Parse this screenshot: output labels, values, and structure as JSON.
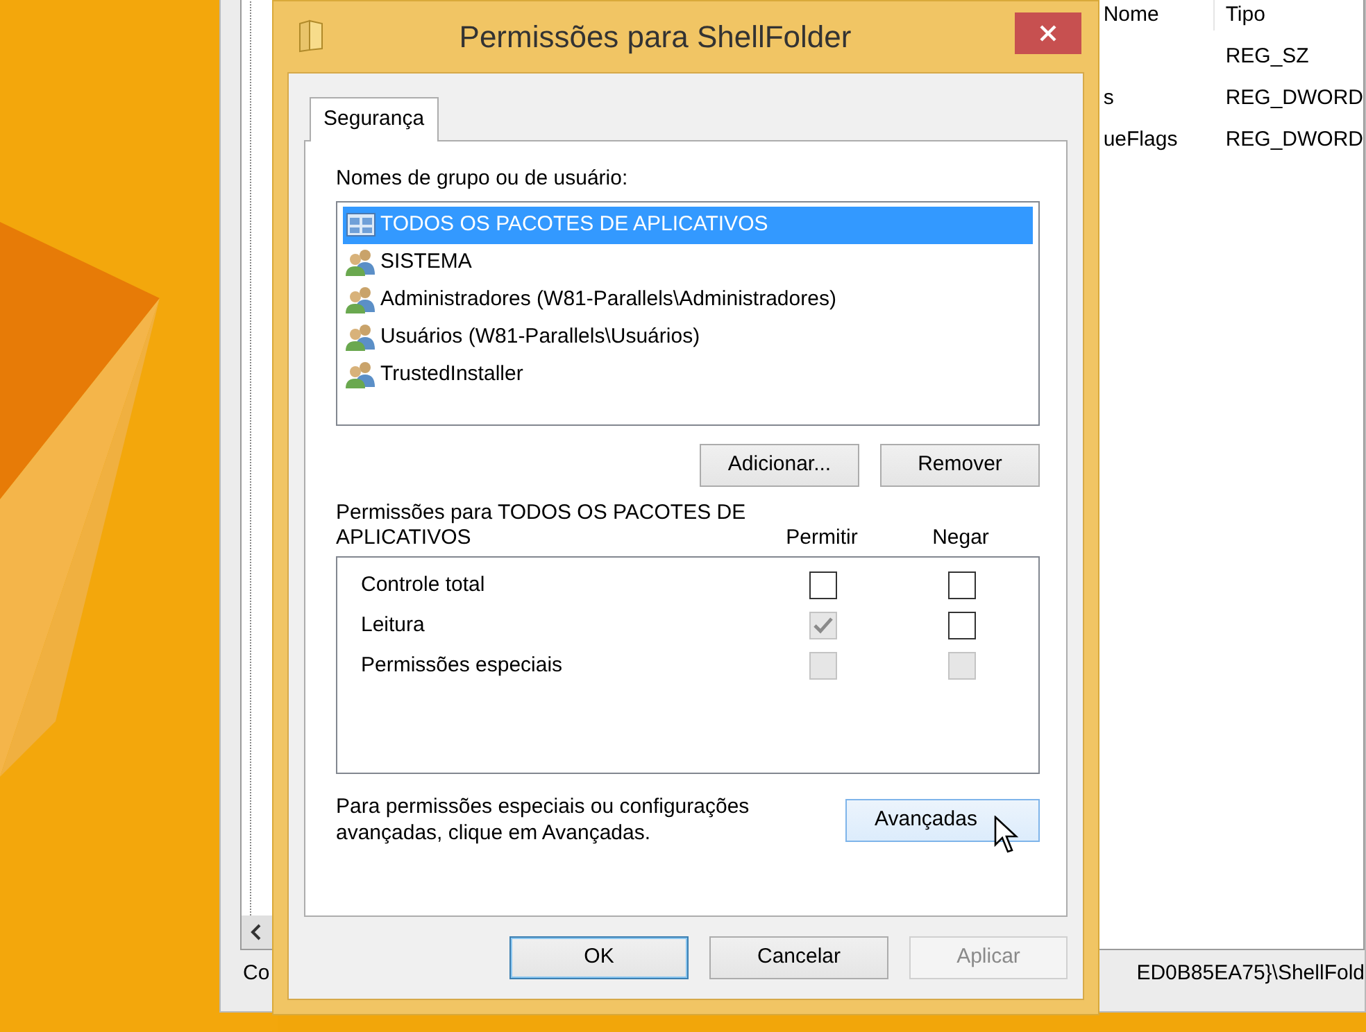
{
  "background_window": {
    "columns": [
      "Nome",
      "Tipo"
    ],
    "rows": [
      {
        "name": "",
        "type": "REG_SZ"
      },
      {
        "name": "s",
        "type": "REG_DWORD"
      },
      {
        "name": "ueFlags",
        "type": "REG_DWORD"
      }
    ],
    "status_bar": {
      "left": "Co",
      "right": "ED0B85EA75}\\ShellFold"
    }
  },
  "dialog": {
    "title": "Permissões para ShellFolder",
    "tabs": [
      {
        "label": "Segurança",
        "selected": true
      }
    ],
    "users_label": "Nomes de grupo ou de usuário:",
    "users": [
      {
        "label": "TODOS OS PACOTES DE APLICATIVOS",
        "kind": "package",
        "selected": true
      },
      {
        "label": "SISTEMA",
        "kind": "group",
        "selected": false
      },
      {
        "label": "Administradores (W81-Parallels\\Administradores)",
        "kind": "group",
        "selected": false
      },
      {
        "label": "Usuários (W81-Parallels\\Usuários)",
        "kind": "group",
        "selected": false
      },
      {
        "label": "TrustedInstaller",
        "kind": "group",
        "selected": false
      }
    ],
    "user_buttons": [
      "Adicionar...",
      "Remover"
    ],
    "permissions_label": "Permissões para TODOS OS PACOTES DE APLICATIVOS",
    "permission_columns": [
      "Permitir",
      "Negar"
    ],
    "permissions": [
      {
        "label": "Controle total",
        "allow": {
          "checked": false,
          "disabled": false
        },
        "deny": {
          "checked": false,
          "disabled": false
        }
      },
      {
        "label": "Leitura",
        "allow": {
          "checked": true,
          "disabled": true
        },
        "deny": {
          "checked": false,
          "disabled": false
        }
      },
      {
        "label": "Permissões especiais",
        "allow": {
          "checked": false,
          "disabled": true
        },
        "deny": {
          "checked": false,
          "disabled": true
        }
      }
    ],
    "advanced_text": "Para permissões especiais ou configurações avançadas, clique em Avançadas.",
    "advanced_button": {
      "label": "Avançadas",
      "hovered": true
    },
    "buttons": [
      {
        "label": "OK",
        "default": true,
        "disabled": false
      },
      {
        "label": "Cancelar",
        "default": false,
        "disabled": false
      },
      {
        "label": "Aplicar",
        "default": false,
        "disabled": true
      }
    ]
  }
}
